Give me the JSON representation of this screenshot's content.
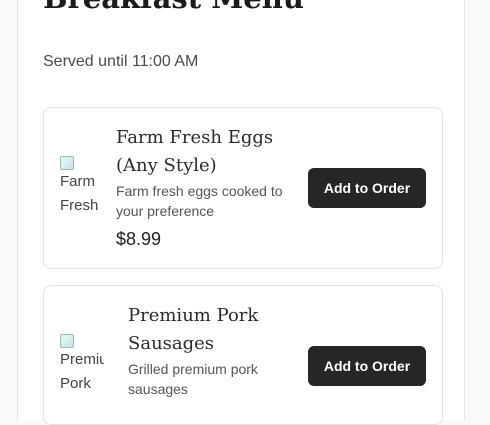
{
  "menu": {
    "title": "Breakfast Menu",
    "served": "Served until 11:00 AM"
  },
  "items": [
    {
      "name": "Farm Fresh Eggs (Any Style)",
      "image_alt": "Farm Fresh",
      "description": "Farm fresh eggs cooked to your preference",
      "price": "$8.99",
      "button_label": "Add to Order"
    },
    {
      "name": "Premium Pork Sausages",
      "image_alt": "Premiu Pork",
      "description": "Grilled premium pork sausages",
      "price": "",
      "button_label": "Add to Order"
    }
  ],
  "colors": {
    "button_bg": "#262626",
    "button_text": "#ffffff",
    "card_border": "#e3e3e3"
  },
  "icons": {
    "thumbnail": "broken-image-icon"
  }
}
